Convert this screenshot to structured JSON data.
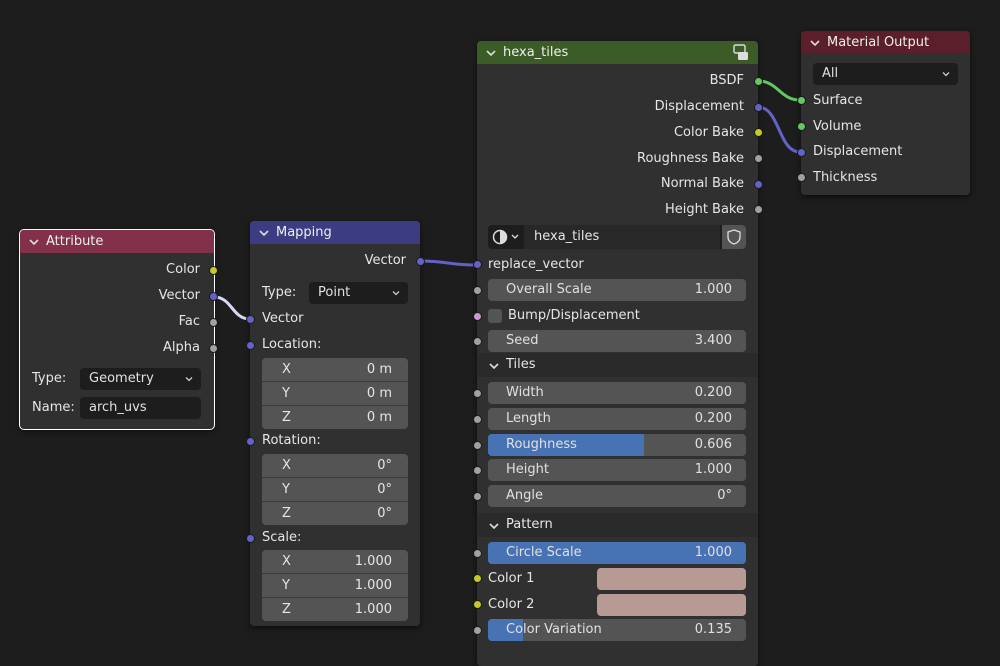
{
  "attribute_node": {
    "title": "Attribute",
    "header_color": "#83314a",
    "outputs": [
      "Color",
      "Vector",
      "Fac",
      "Alpha"
    ],
    "type_label": "Type:",
    "type_value": "Geometry",
    "name_label": "Name:",
    "name_value": "arch_uvs"
  },
  "mapping_node": {
    "title": "Mapping",
    "header_color": "#3c3c83",
    "output": "Vector",
    "type_label": "Type:",
    "type_value": "Point",
    "inputs": {
      "vector": "Vector",
      "location": "Location:",
      "rotation": "Rotation:",
      "scale": "Scale:"
    },
    "location": [
      {
        "axis": "X",
        "value": "0 m"
      },
      {
        "axis": "Y",
        "value": "0 m"
      },
      {
        "axis": "Z",
        "value": "0 m"
      }
    ],
    "rotation": [
      {
        "axis": "X",
        "value": "0°"
      },
      {
        "axis": "Y",
        "value": "0°"
      },
      {
        "axis": "Z",
        "value": "0°"
      }
    ],
    "scale": [
      {
        "axis": "X",
        "value": "1.000"
      },
      {
        "axis": "Y",
        "value": "1.000"
      },
      {
        "axis": "Z",
        "value": "1.000"
      }
    ]
  },
  "hexa_node": {
    "title": "hexa_tiles",
    "header_color": "#3b5b27",
    "outputs": [
      "BSDF",
      "Displacement",
      "Color Bake",
      "Roughness Bake",
      "Normal Bake",
      "Height Bake"
    ],
    "group_name": "hexa_tiles",
    "replace_vector": "replace_vector",
    "overall_scale": {
      "label": "Overall Scale",
      "value": "1.000"
    },
    "bump": "Bump/Displacement",
    "seed": {
      "label": "Seed",
      "value": "3.400"
    },
    "tiles_panel": "Tiles",
    "tiles": [
      {
        "label": "Width",
        "value": "0.200",
        "fill": 0
      },
      {
        "label": "Length",
        "value": "0.200",
        "fill": 0
      },
      {
        "label": "Roughness",
        "value": "0.606",
        "fill": 0.606
      },
      {
        "label": "Height",
        "value": "1.000",
        "fill": 0
      },
      {
        "label": "Angle",
        "value": "0°",
        "fill": 0
      }
    ],
    "pattern_panel": "Pattern",
    "circle_scale": {
      "label": "Circle Scale",
      "value": "1.000",
      "fill": 1.0
    },
    "color1": "Color 1",
    "color2": "Color 2",
    "swatch_color": "#b89a94",
    "color_variation": {
      "label": "Color Variation",
      "value": "0.135",
      "fill": 0.135
    }
  },
  "material_output": {
    "title": "Material Output",
    "header_color": "#5a1f2b",
    "target": "All",
    "inputs": [
      "Surface",
      "Volume",
      "Displacement",
      "Thickness"
    ]
  },
  "colors": {
    "socket_color": "#c7c729",
    "socket_vector": "#6363c7",
    "socket_float": "#a1a1a1",
    "socket_shader": "#63c763",
    "socket_bump": "#cc99cc",
    "link_vector": "#6363c7",
    "link_shader": "#63c763"
  }
}
